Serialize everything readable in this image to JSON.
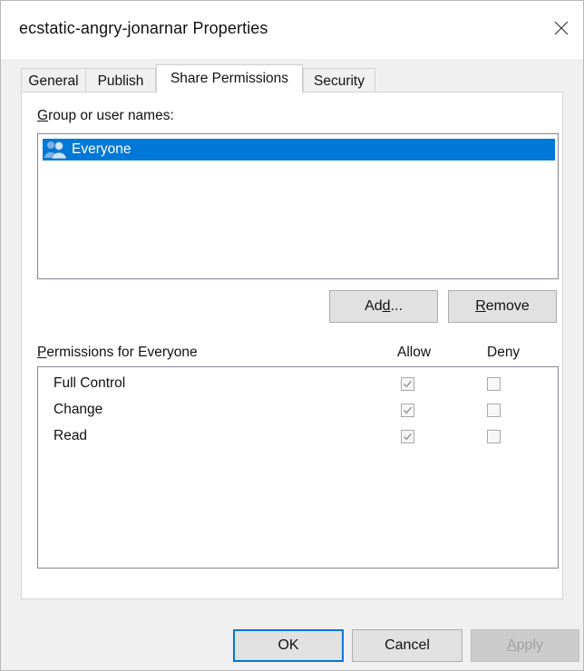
{
  "window": {
    "title": "ecstatic-angry-jonarnar Properties"
  },
  "tabs": [
    {
      "label": "General",
      "active": false
    },
    {
      "label": "Publish",
      "active": false
    },
    {
      "label": "Share Permissions",
      "active": true
    },
    {
      "label": "Security",
      "active": false
    }
  ],
  "group_section": {
    "label": "Group or user names:",
    "users": [
      {
        "name": "Everyone",
        "selected": true,
        "icon": "users-group-icon"
      }
    ]
  },
  "group_buttons": {
    "add": "Add...",
    "remove": "Remove"
  },
  "permissions": {
    "label": "Permissions for Everyone",
    "allow_header": "Allow",
    "deny_header": "Deny",
    "rows": [
      {
        "name": "Full Control",
        "allow": true,
        "deny": false
      },
      {
        "name": "Change",
        "allow": true,
        "deny": false
      },
      {
        "name": "Read",
        "allow": true,
        "deny": false
      }
    ]
  },
  "dialog_buttons": {
    "ok": "OK",
    "cancel": "Cancel",
    "apply": "Apply"
  },
  "colors": {
    "selection": "#0078d7",
    "dialog_bg": "#f0f0f0",
    "check_disabled": "#8a8a8a"
  }
}
